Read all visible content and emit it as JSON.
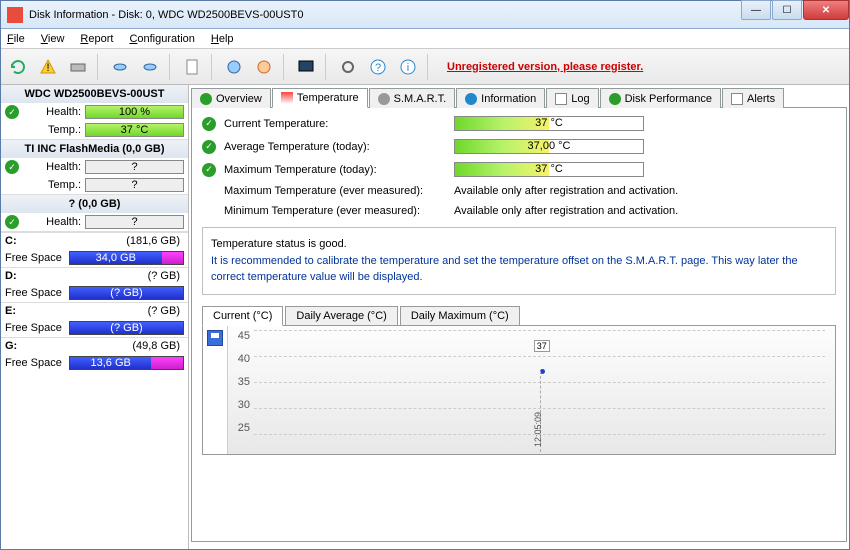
{
  "window": {
    "title": "Disk Information - Disk: 0, WDC WD2500BEVS-00UST0"
  },
  "menu": {
    "file": "File",
    "view": "View",
    "report": "Report",
    "config": "Configuration",
    "help": "Help"
  },
  "toolbar": {
    "register": "Unregistered version, please register."
  },
  "sidebar": {
    "devices": [
      {
        "name": "WDC WD2500BEVS-00UST",
        "health": "100 %",
        "temp": "37 °C",
        "status": "ok"
      },
      {
        "name": "TI INC  FlashMedia  (0,0 GB)",
        "health": "?",
        "temp": "?",
        "status": "ok"
      },
      {
        "name": "?  (0,0 GB)",
        "health": "?",
        "status": "ok"
      }
    ],
    "partitions": [
      {
        "letter": "C:",
        "size": "(181,6 GB)",
        "free": "34,0 GB",
        "usedPct": 81
      },
      {
        "letter": "D:",
        "size": "(? GB)",
        "free": "(? GB)",
        "usedPct": 100
      },
      {
        "letter": "E:",
        "size": "(? GB)",
        "free": "(? GB)",
        "usedPct": 100
      },
      {
        "letter": "G:",
        "size": "(49,8 GB)",
        "free": "13,6 GB",
        "usedPct": 72
      }
    ],
    "labels": {
      "health": "Health:",
      "temp": "Temp.:",
      "free": "Free Space"
    }
  },
  "tabs": {
    "overview": "Overview",
    "temperature": "Temperature",
    "smart": "S.M.A.R.T.",
    "info": "Information",
    "log": "Log",
    "perf": "Disk Performance",
    "alerts": "Alerts"
  },
  "temp": {
    "currentLbl": "Current Temperature:",
    "current": "37 °C",
    "avgLbl": "Average Temperature (today):",
    "avg": "37,00 °C",
    "maxLbl": "Maximum Temperature (today):",
    "max": "37 °C",
    "maxEverLbl": "Maximum Temperature (ever measured):",
    "minEverLbl": "Minimum Temperature (ever measured):",
    "regOnly": "Available only after registration and activation.",
    "statusGood": "Temperature status is good.",
    "advice": "It is recommended to calibrate the temperature and set the temperature offset on the S.M.A.R.T. page. This way later the correct temperature value will be displayed."
  },
  "chart": {
    "tabCurrent": "Current (°C)",
    "tabAvg": "Daily Average (°C)",
    "tabMax": "Daily Maximum (°C)",
    "time": "12:05:09",
    "pointLabel": "37"
  },
  "chart_data": {
    "type": "line",
    "title": "Current (°C)",
    "xlabel": "",
    "ylabel": "",
    "ylim": [
      25,
      45
    ],
    "yticks": [
      25,
      30,
      35,
      40,
      45
    ],
    "series": [
      {
        "name": "Temperature",
        "x": [
          "12:05:09"
        ],
        "values": [
          37
        ]
      }
    ]
  }
}
